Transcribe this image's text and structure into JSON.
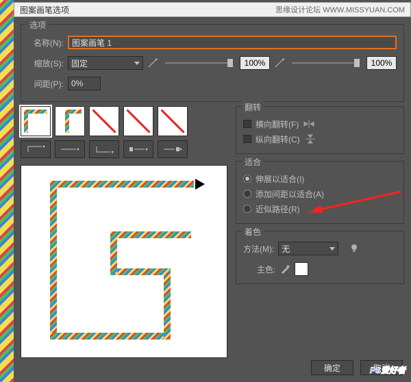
{
  "title_bar": {
    "title": "图案画笔选项",
    "right": "思缘设计论坛  WWW.MISSYUAN.COM"
  },
  "options_group": "选项",
  "name_label": "名称(N):",
  "name_value": "图案画笔 1",
  "scale_label": "缩放(S):",
  "scale_mode": "固定",
  "scale_pct_1": "100%",
  "scale_pct_2": "100%",
  "spacing_label": "间距(P):",
  "spacing_value": "0%",
  "flip_group": "翻转",
  "flip_h": "横向翻转(F)",
  "flip_v": "纵向翻转(C)",
  "fit_group": "适合",
  "fit_stretch": "伸展以适合(I)",
  "fit_addspace": "添加间距以适合(A)",
  "fit_approx": "近似路径(R)",
  "colorize_group": "着色",
  "method_label": "方法(M):",
  "method_value": "无",
  "keycolor_label": "主色:",
  "ok": "确定",
  "cancel": "取消",
  "watermark1": "PS",
  "watermark2": "爱好者"
}
